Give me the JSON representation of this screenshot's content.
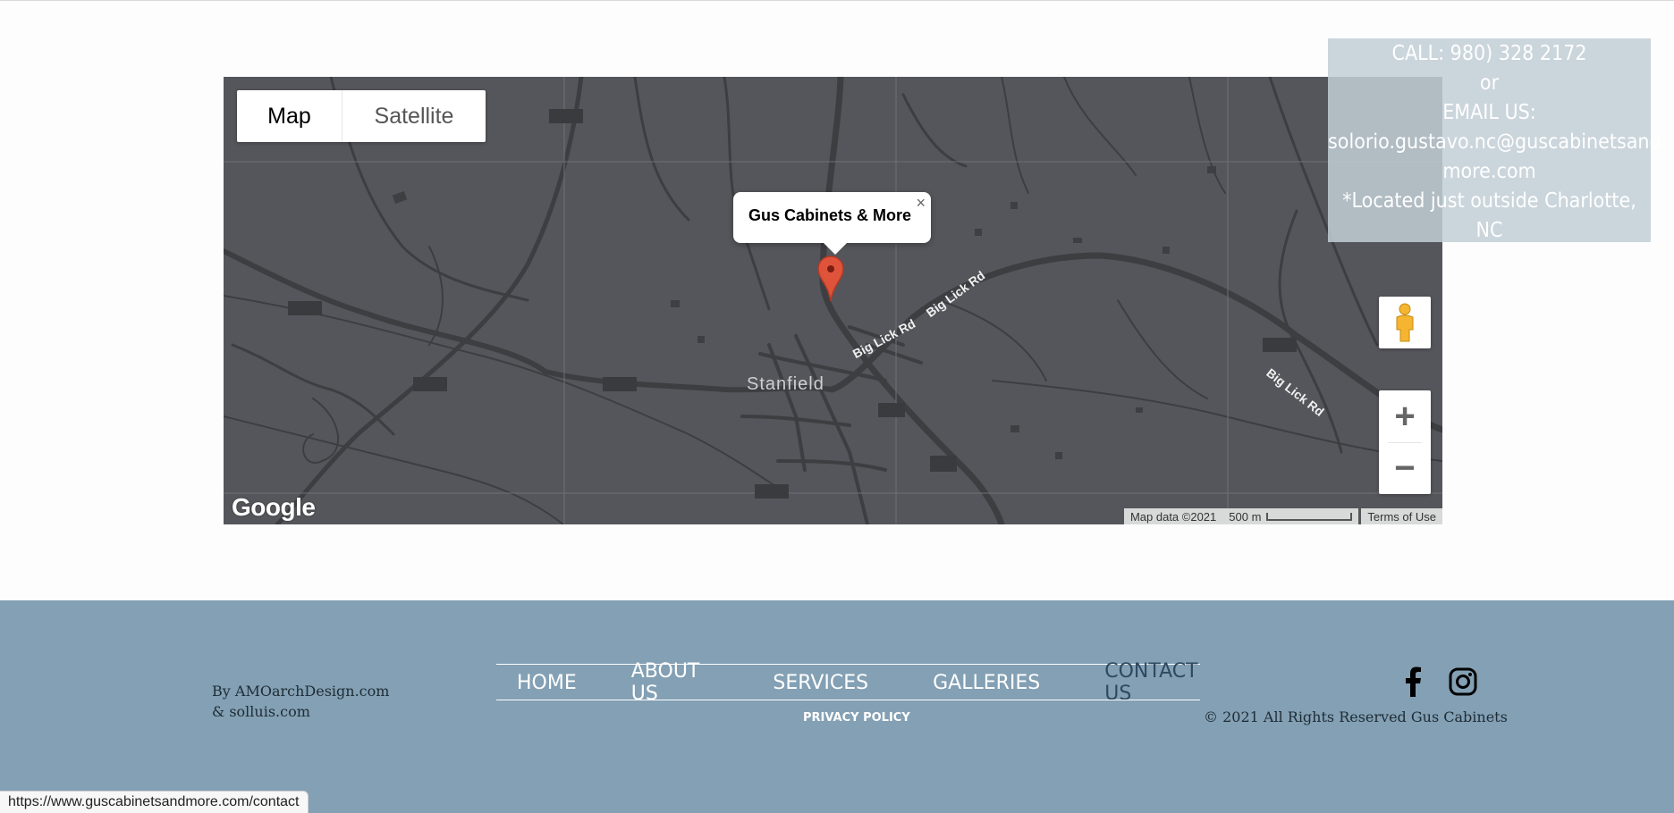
{
  "map": {
    "type_map": "Map",
    "type_satellite": "Satellite",
    "info_title": "Gus Cabinets & More",
    "close_glyph": "×",
    "place_name": "Stanfield",
    "road_label": "Big Lick Rd",
    "google": "Google",
    "map_data": "Map data ©2021",
    "scale": "500 m",
    "terms": "Terms of Use",
    "zoom_in": "+",
    "zoom_out": "−",
    "pegman_icon": "pegman-icon"
  },
  "contact": {
    "call": "CALL: 980) 328 2172",
    "or": "or",
    "email_label": "EMAIL US:",
    "email_line1": "solorio.gustavo.nc@guscabinetsand",
    "email_line2": "more.com",
    "location": "*Located just outside Charlotte, NC"
  },
  "footer": {
    "credit_line1": "By AMOarchDesign.com",
    "credit_line2": "& solluis.com",
    "nav": [
      "HOME",
      "ABOUT US",
      "SERVICES",
      "GALLERIES",
      "CONTACT US"
    ],
    "privacy": "PRIVACY POLICY",
    "copyright": "© 2021 All Rights Reserved Gus Cabinets",
    "social_icons": [
      "facebook-icon",
      "instagram-icon"
    ]
  },
  "status_url": "https://www.guscabinetsandmore.com/contact",
  "colors": {
    "footer_bg": "#83a0b4",
    "map_bg": "#55565b",
    "active_nav": "#2e4a61",
    "pin": "#e0533b"
  }
}
